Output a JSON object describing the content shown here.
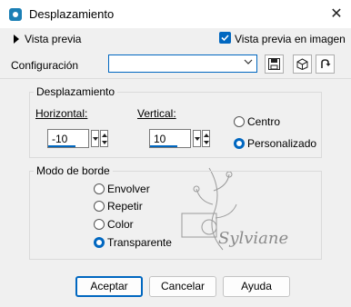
{
  "window": {
    "title": "Desplazamiento",
    "close_glyph": "✕"
  },
  "preview": {
    "toggle_label": "Vista previa",
    "checkbox_label": "Vista previa en imagen",
    "checkbox_checked": true
  },
  "config": {
    "label": "Configuración",
    "value": ""
  },
  "offset": {
    "group_title": "Desplazamiento",
    "horizontal_label": "Horizontal:",
    "horizontal_value": "-10",
    "vertical_label": "Vertical:",
    "vertical_value": "10",
    "options": [
      {
        "label": "Centro",
        "selected": false
      },
      {
        "label": "Personalizado",
        "selected": true
      }
    ]
  },
  "edge_mode": {
    "group_title": "Modo de borde",
    "options": [
      {
        "label": "Envolver",
        "selected": false
      },
      {
        "label": "Repetir",
        "selected": false
      },
      {
        "label": "Color",
        "selected": false
      },
      {
        "label": "Transparente",
        "selected": true
      }
    ]
  },
  "watermark": "Sylviane",
  "buttons": {
    "ok": "Aceptar",
    "cancel": "Cancelar",
    "help": "Ayuda"
  },
  "colors": {
    "accent": "#0067c0",
    "background": "#f0f0f0"
  },
  "icons": [
    "app-icon",
    "save-icon",
    "database-icon",
    "reset-icon",
    "chevron-down-icon",
    "spin-up-icon",
    "spin-down-icon"
  ]
}
